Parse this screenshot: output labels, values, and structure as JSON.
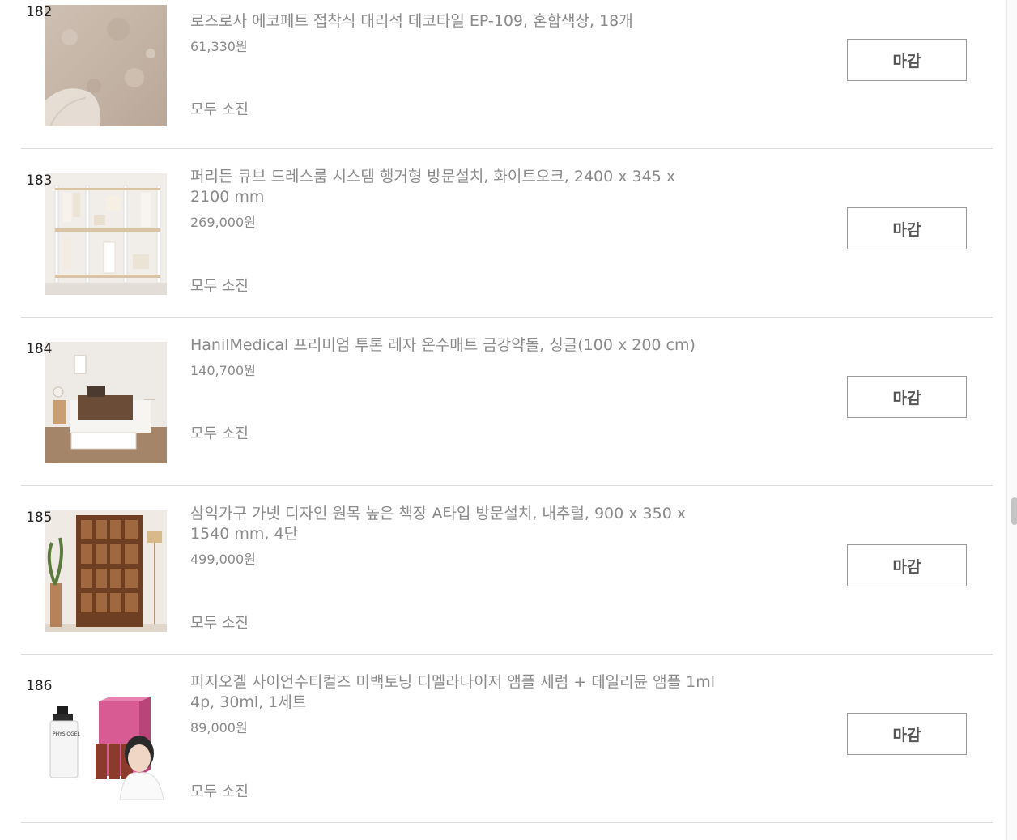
{
  "items": [
    {
      "num": "182",
      "title": "로즈로사 에코페트 접착식 대리석 데코타일 EP-109, 혼합색상, 18개",
      "price": "61,330원",
      "status": "모두 소진",
      "button": "마감"
    },
    {
      "num": "183",
      "title": "퍼리든 큐브 드레스룸 시스템 행거형 방문설치, 화이트오크, 2400 x 345 x 2100 mm",
      "price": "269,000원",
      "status": "모두 소진",
      "button": "마감"
    },
    {
      "num": "184",
      "title": "HanilMedical 프리미엄 투톤 레자 온수매트 금강약돌, 싱글(100 x 200 cm)",
      "price": "140,700원",
      "status": "모두 소진",
      "button": "마감"
    },
    {
      "num": "185",
      "title": "삼익가구 가넷 디자인 원목 높은 책장 A타입 방문설치, 내추럴, 900 x 350 x 1540 mm, 4단",
      "price": "499,000원",
      "status": "모두 소진",
      "button": "마감"
    },
    {
      "num": "186",
      "title": "피지오겔 사이언수티컬즈 미백토닝 디멜라나이저 앰플 세럼 + 데일리뮨 앰플 1ml 4p, 30ml, 1세트",
      "price": "89,000원",
      "status": "모두 소진",
      "button": "마감"
    }
  ],
  "thumbnails": [
    "marble-tile-image",
    "dressroom-hanger-image",
    "heated-mat-bed-image",
    "wooden-bookshelf-image",
    "ampoule-serum-set-image"
  ],
  "product_brand_on_bottle": "PHYSIOGEL"
}
